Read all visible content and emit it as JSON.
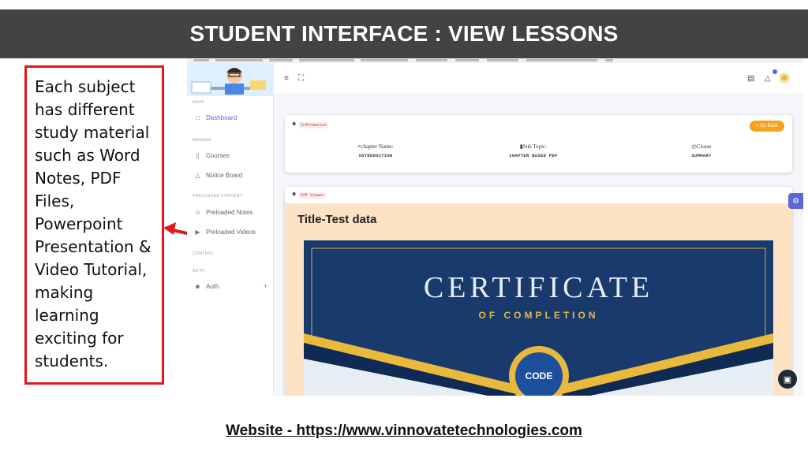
{
  "slide": {
    "title": "STUDENT INTERFACE : VIEW LESSONS",
    "callout": "Each subject has different study material such as Word Notes, PDF Files, Powerpoint Presentation & Video Tutorial, making learning exciting for students.",
    "footer": "Website - https://www.vinnovatetechnologies.com"
  },
  "colors": {
    "title_bar": "#434343",
    "callout_border": "#e3171b",
    "accent": "#5b67d8",
    "go_back": "#f7a21b",
    "viewer_bg": "#fde2c3"
  },
  "sidebar": {
    "sections": {
      "main": "MAIN",
      "manage": "MANAGE",
      "preloaded": "PRELOADED CONTENT",
      "control": "CONTROL",
      "auth": "AUTH"
    },
    "items": [
      {
        "label": "Dashboard",
        "icon": "monitor-icon",
        "active": true
      },
      {
        "label": "Courses",
        "icon": "book-icon"
      },
      {
        "label": "Notice Board",
        "icon": "warning-icon"
      },
      {
        "label": "Preloaded Notes",
        "icon": "users-icon"
      },
      {
        "label": "Preloaded Videos",
        "icon": "video-icon"
      },
      {
        "label": "Auth",
        "icon": "user-key-icon",
        "expand": "+"
      }
    ]
  },
  "topbar": {
    "icons": [
      "menu-icon",
      "fullscreen-icon",
      "calendar-icon",
      "bell-icon",
      "avatar-medal-icon"
    ]
  },
  "info_card": {
    "tag": "Information",
    "go_back": "+ Go Back",
    "columns": [
      {
        "header": "chapter Name:",
        "value": "INTRODUCTION",
        "icon": "list-icon"
      },
      {
        "header": "Sub Topic:",
        "value": "CHAPTER BASED PDF",
        "icon": "book-icon"
      },
      {
        "header": "Closse",
        "value": "SUMMARY",
        "icon": "clock-icon"
      }
    ]
  },
  "pdf_card": {
    "tag": "Pdf Viewer",
    "title": "Title-Test data",
    "certificate": {
      "heading": "CERTIFICATE",
      "sub": "OF COMPLETION",
      "logo": "CODE"
    }
  }
}
